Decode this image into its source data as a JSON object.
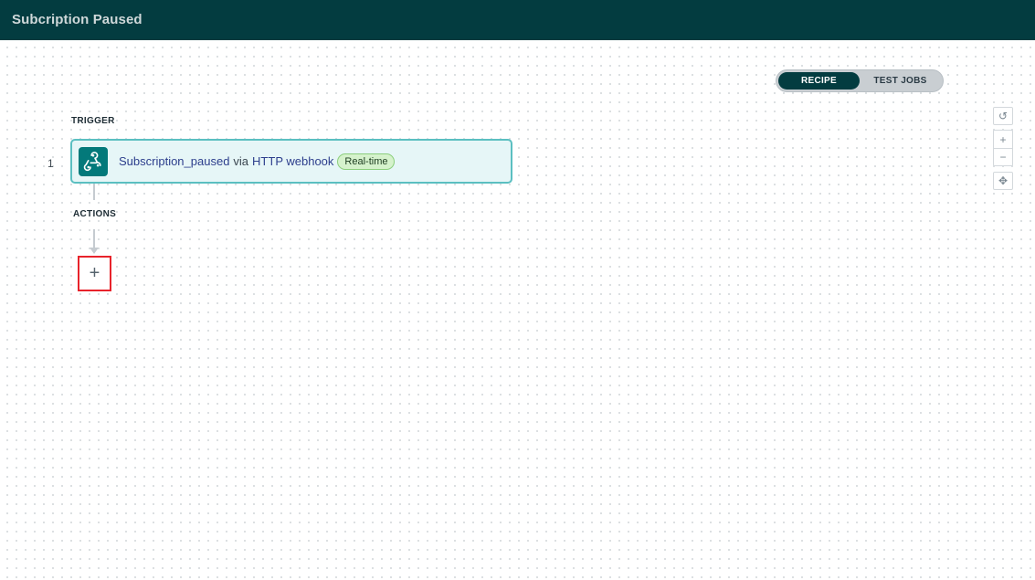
{
  "header": {
    "title": "Subcription Paused",
    "bg_color": "#033c40"
  },
  "view_toggle": {
    "active_label": "RECIPE",
    "inactive_label": "TEST JOBS"
  },
  "zoom_controls": {
    "reset_icon": "↺",
    "zoom_in_icon": "+",
    "zoom_out_icon": "−",
    "fit_icon": "✥"
  },
  "recipe": {
    "trigger_label": "TRIGGER",
    "actions_label": "ACTIONS",
    "trigger_step": {
      "number": "1",
      "event": "Subscription_paused",
      "via": "via",
      "connector": "HTTP webhook",
      "badge": "Real-time",
      "icon": "webhook-icon",
      "icon_bg": "#03797a"
    },
    "add_action_label": "+"
  }
}
